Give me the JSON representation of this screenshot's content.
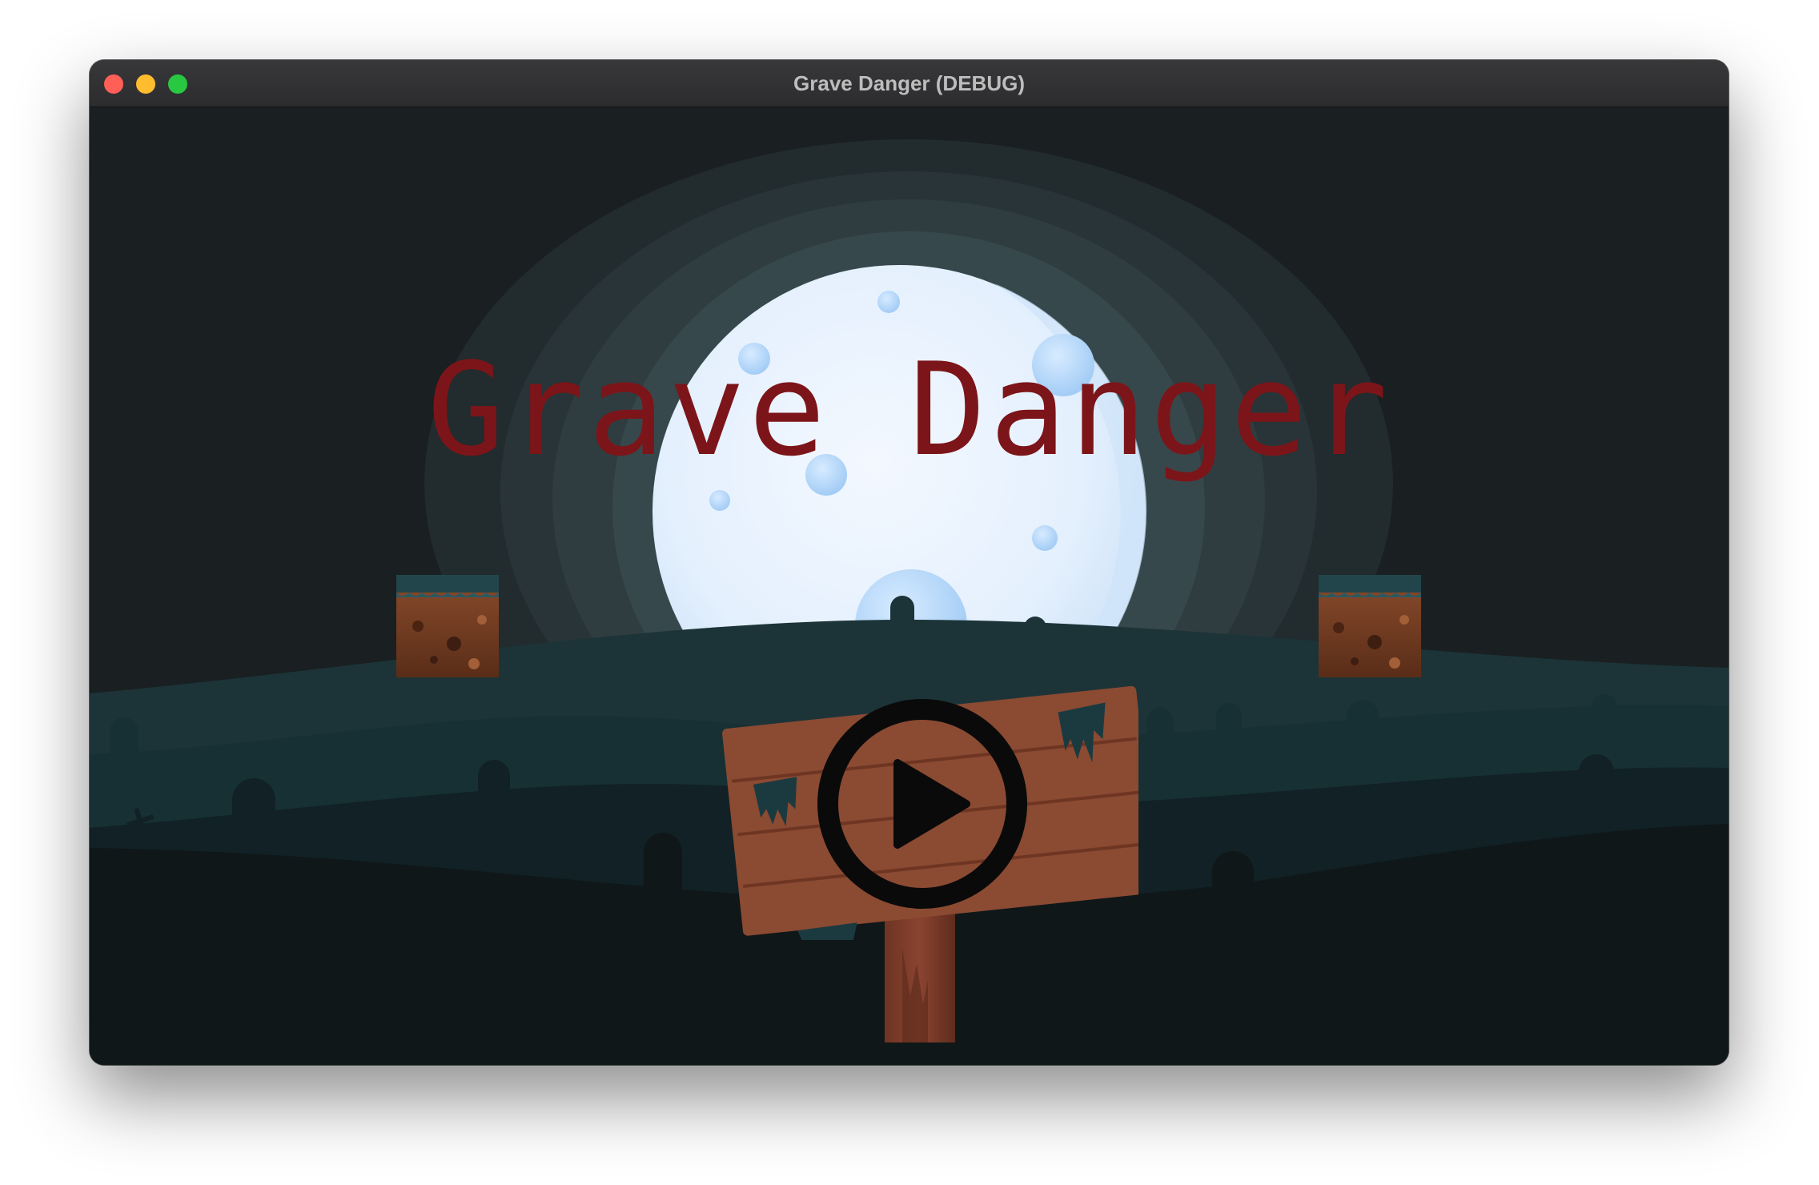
{
  "window": {
    "title": "Grave Danger (DEBUG)",
    "controls": [
      "close",
      "minimize",
      "zoom"
    ],
    "colors": {
      "close": "#ff5f57",
      "minimize": "#febc2e",
      "zoom": "#28c840"
    }
  },
  "game": {
    "title": "Grave Danger",
    "title_color": "#7c1519",
    "play_icon": "play-icon",
    "sign_color": "#8b4a32",
    "moon_color": "#e6f2fe"
  }
}
